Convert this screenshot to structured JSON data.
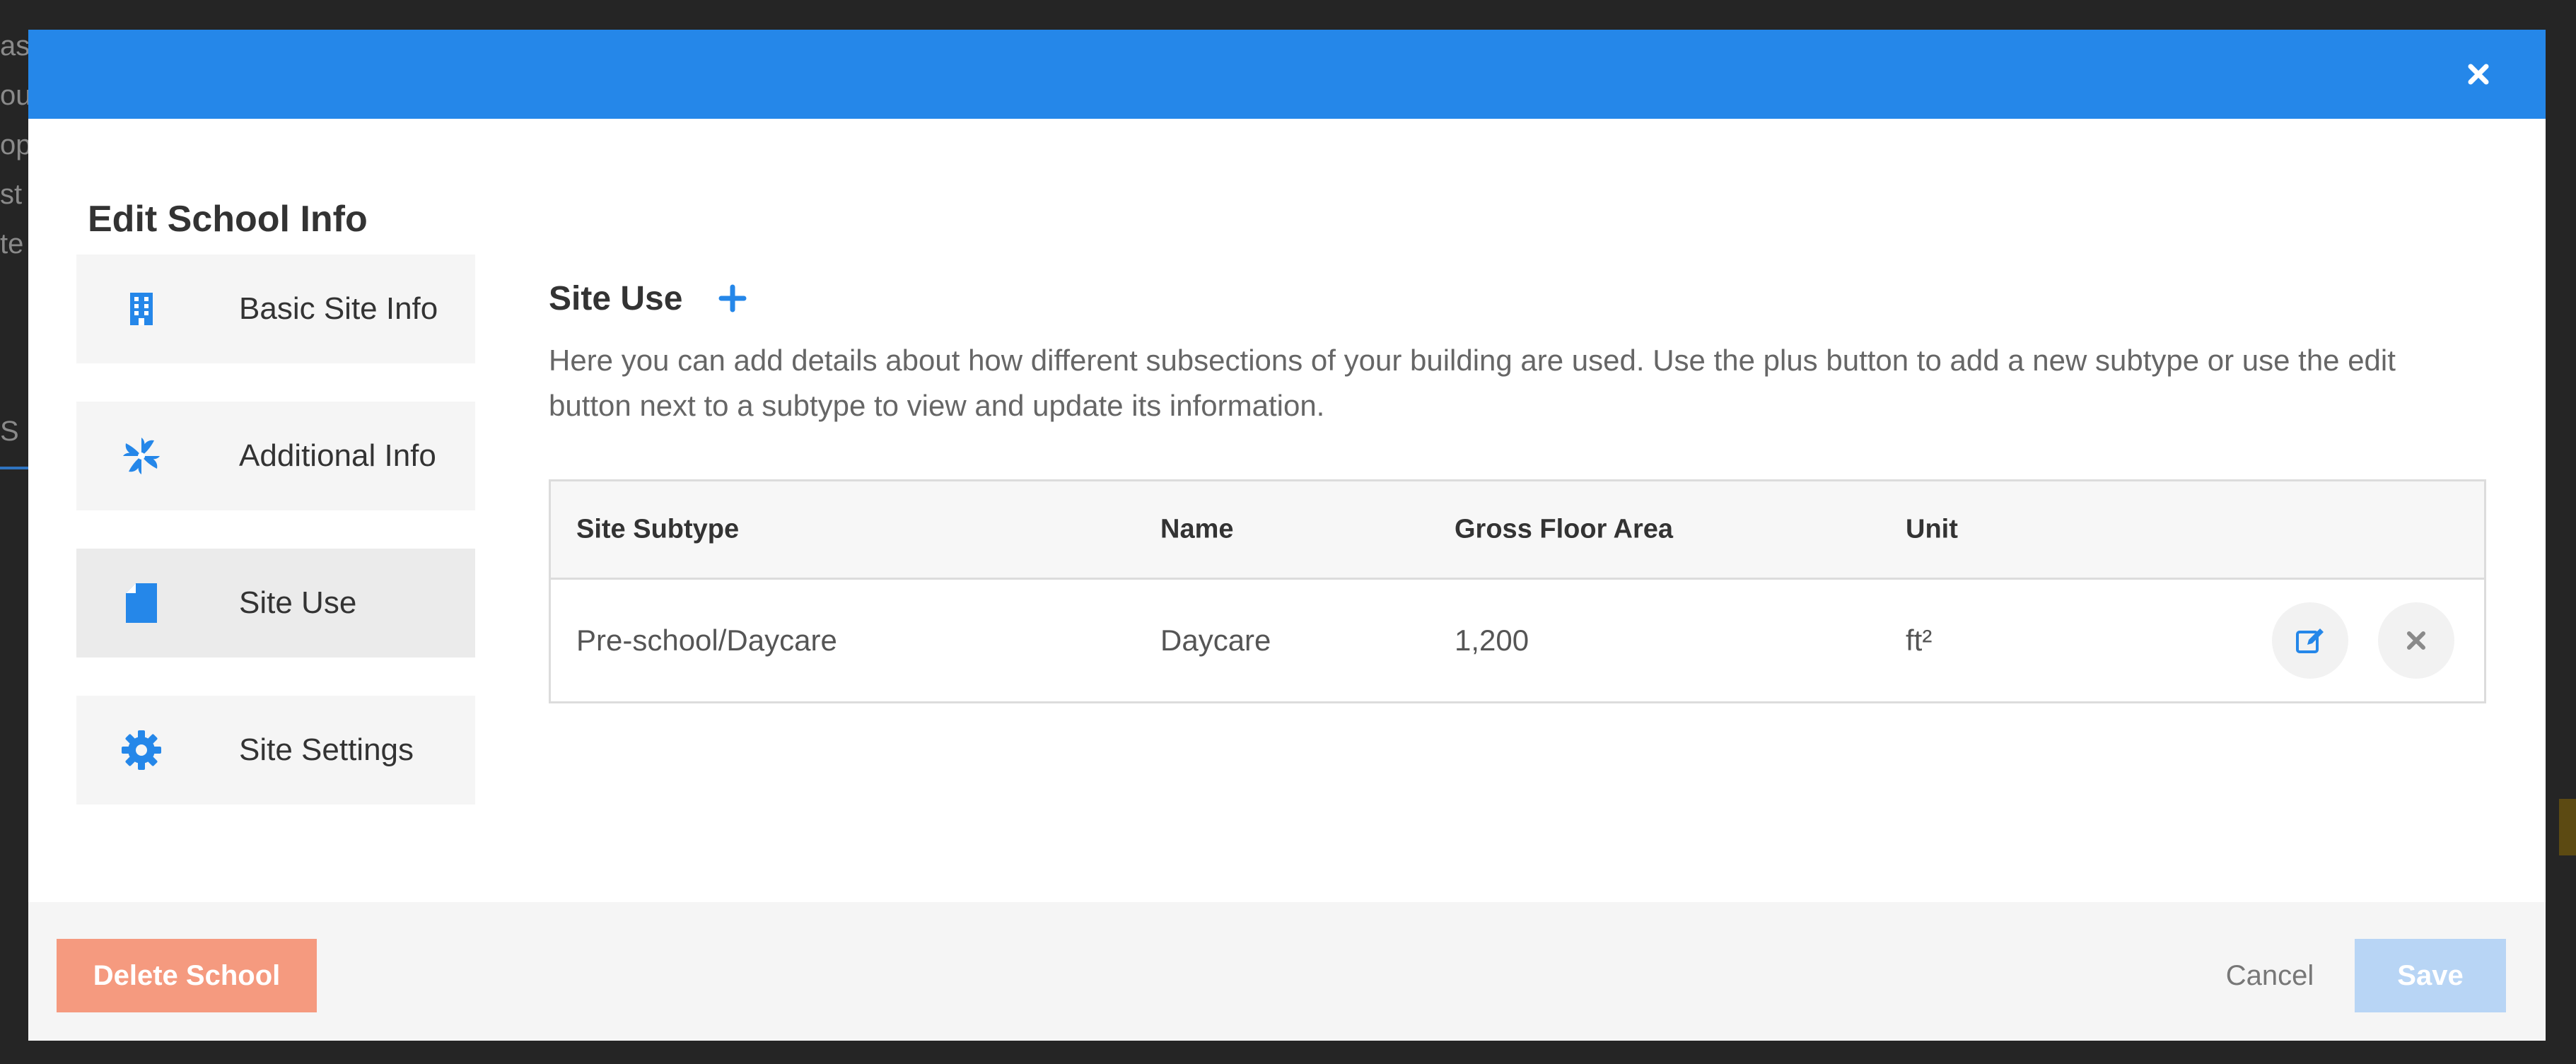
{
  "background": {
    "text_fragments": [
      "as",
      "ou",
      "op",
      "st",
      "te"
    ],
    "tab_fragment": "S"
  },
  "modal": {
    "title": "Edit School Info",
    "accent_color": "#2587e9"
  },
  "sidebar": {
    "items": [
      {
        "label": "Basic Site Info",
        "icon": "building-icon",
        "active": false
      },
      {
        "label": "Additional Info",
        "icon": "pinwheel-icon",
        "active": false
      },
      {
        "label": "Site Use",
        "icon": "document-icon",
        "active": true
      },
      {
        "label": "Site Settings",
        "icon": "gear-icon",
        "active": false
      }
    ]
  },
  "site_use": {
    "title": "Site Use",
    "description": "Here you can add details about how different subsections of your building are used. Use the plus button to add a new subtype or use the edit button next to a subtype to view and update its information.",
    "table": {
      "headers": [
        "Site Subtype",
        "Name",
        "Gross Floor Area",
        "Unit"
      ],
      "rows": [
        {
          "subtype": "Pre-school/Daycare",
          "name": "Daycare",
          "gross_floor_area": "1,200",
          "unit": "ft²"
        }
      ]
    }
  },
  "footer": {
    "delete_label": "Delete School",
    "cancel_label": "Cancel",
    "save_label": "Save",
    "delete_color": "#f59a7f",
    "save_color": "#b8d5f5"
  }
}
